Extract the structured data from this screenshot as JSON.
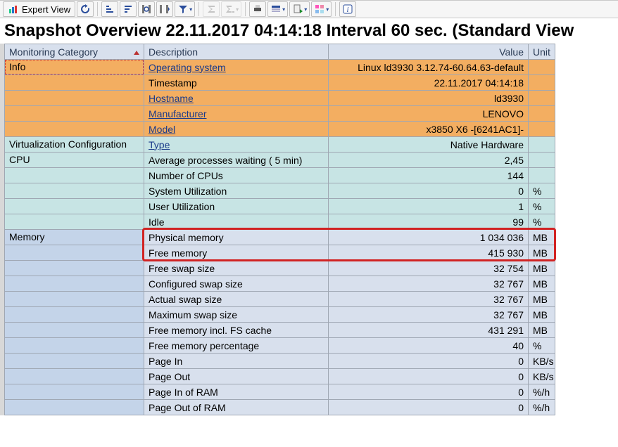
{
  "toolbar": {
    "expert_view_label": "Expert View"
  },
  "title": "Snapshot Overview 22.11.2017 04:14:18 Interval 60 sec. (Standard View",
  "columns": {
    "cat": "Monitoring Category",
    "desc": "Description",
    "val": "Value",
    "unit": "Unit"
  },
  "rows": [
    {
      "cat": "Info",
      "desc": "Operating system",
      "val": "Linux ld3930 3.12.74-60.64.63-default",
      "unit": "",
      "link": true,
      "theme": "orange"
    },
    {
      "cat": "",
      "desc": "Timestamp",
      "val": "22.11.2017 04:14:18",
      "unit": "",
      "link": false,
      "theme": "orange"
    },
    {
      "cat": "",
      "desc": "Hostname",
      "val": "ld3930",
      "unit": "",
      "link": true,
      "theme": "orange"
    },
    {
      "cat": "",
      "desc": "Manufacturer",
      "val": "LENOVO",
      "unit": "",
      "link": true,
      "theme": "orange"
    },
    {
      "cat": "",
      "desc": "Model",
      "val": "x3850 X6 -[6241AC1]-",
      "unit": "",
      "link": true,
      "theme": "orange"
    },
    {
      "cat": "Virtualization Configuration",
      "desc": "Type",
      "val": "Native Hardware",
      "unit": "",
      "link": true,
      "theme": "teal"
    },
    {
      "cat": "CPU",
      "desc": "Average processes waiting (   5 min)",
      "val": "2,45",
      "unit": "",
      "link": false,
      "theme": "teal"
    },
    {
      "cat": "",
      "desc": "Number of CPUs",
      "val": "144",
      "unit": "",
      "link": false,
      "theme": "teal"
    },
    {
      "cat": "",
      "desc": "System Utilization",
      "val": "0",
      "unit": "%",
      "link": false,
      "theme": "teal"
    },
    {
      "cat": "",
      "desc": "User Utilization",
      "val": "1",
      "unit": "%",
      "link": false,
      "theme": "teal"
    },
    {
      "cat": "",
      "desc": "Idle",
      "val": "99",
      "unit": "%",
      "link": false,
      "theme": "teal"
    },
    {
      "cat": "Memory",
      "desc": "Physical memory",
      "val": "1 034 036",
      "unit": "MB",
      "link": false,
      "theme": "blue"
    },
    {
      "cat": "",
      "desc": "Free memory",
      "val": "415 930",
      "unit": "MB",
      "link": false,
      "theme": "blue"
    },
    {
      "cat": "",
      "desc": "Free swap size",
      "val": "32 754",
      "unit": "MB",
      "link": false,
      "theme": "blue"
    },
    {
      "cat": "",
      "desc": "Configured swap size",
      "val": "32 767",
      "unit": "MB",
      "link": false,
      "theme": "blue"
    },
    {
      "cat": "",
      "desc": "Actual swap size",
      "val": "32 767",
      "unit": "MB",
      "link": false,
      "theme": "blue"
    },
    {
      "cat": "",
      "desc": "Maximum swap size",
      "val": "32 767",
      "unit": "MB",
      "link": false,
      "theme": "blue"
    },
    {
      "cat": "",
      "desc": "Free memory incl. FS cache",
      "val": "431 291",
      "unit": "MB",
      "link": false,
      "theme": "blue"
    },
    {
      "cat": "",
      "desc": "Free memory percentage",
      "val": "40",
      "unit": "%",
      "link": false,
      "theme": "blue"
    },
    {
      "cat": "",
      "desc": "Page In",
      "val": "0",
      "unit": "KB/s",
      "link": false,
      "theme": "blue"
    },
    {
      "cat": "",
      "desc": "Page Out",
      "val": "0",
      "unit": "KB/s",
      "link": false,
      "theme": "blue"
    },
    {
      "cat": "",
      "desc": "Page In of RAM",
      "val": "0",
      "unit": "%/h",
      "link": false,
      "theme": "blue"
    },
    {
      "cat": "",
      "desc": "Page Out of RAM",
      "val": "0",
      "unit": "%/h",
      "link": false,
      "theme": "blue"
    }
  ]
}
